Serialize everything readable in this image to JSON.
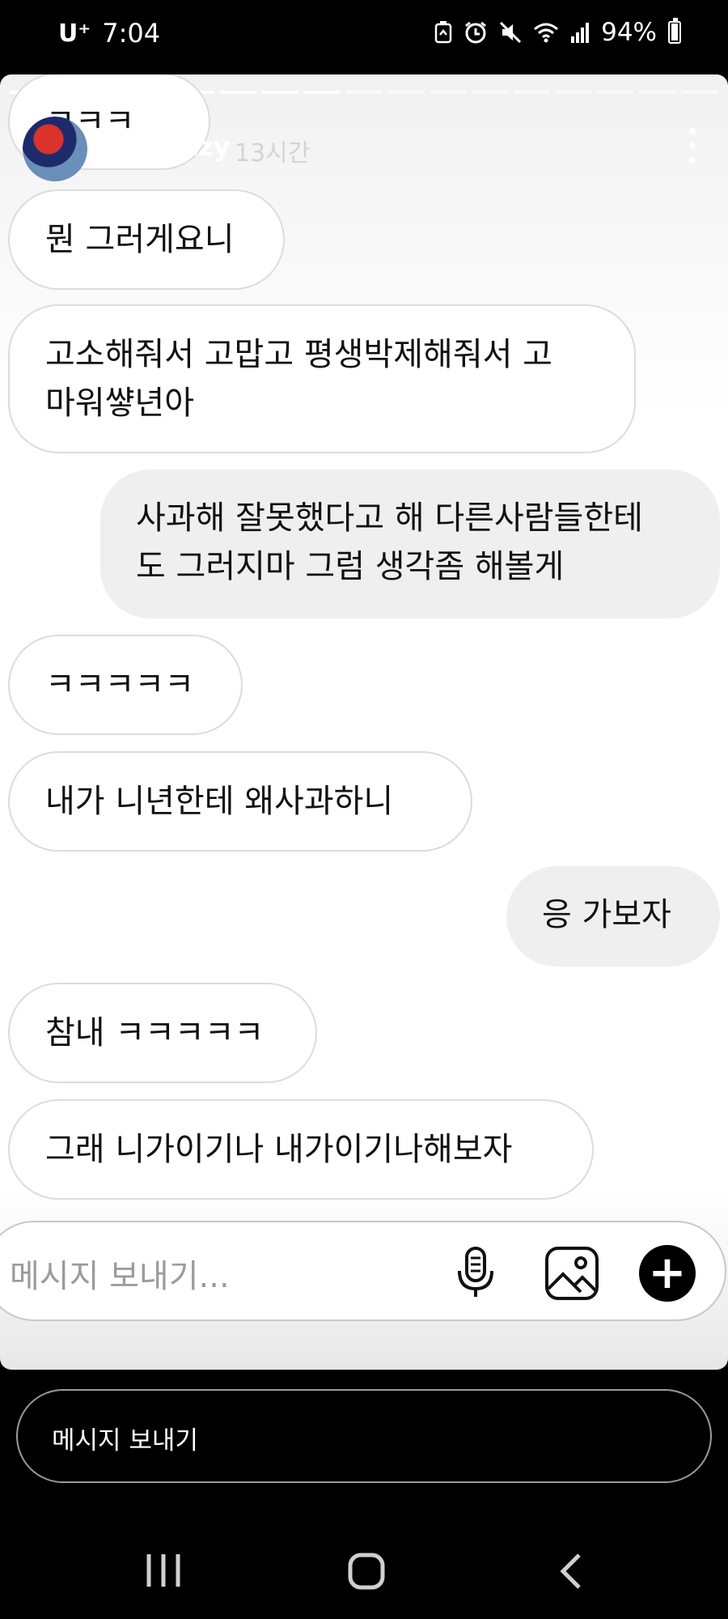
{
  "status_bar": {
    "carrier": "U⁺",
    "time": "7:04",
    "battery": "94%"
  },
  "story": {
    "progress": {
      "total_segments": 17,
      "completed_segments": 8
    },
    "username": "luvlyzzy",
    "time_ago": "13시간"
  },
  "messages": [
    {
      "text": "ㅋㅋㅋ",
      "sender": "other"
    },
    {
      "text": "뭔 그러게요니",
      "sender": "other"
    },
    {
      "text": "고소해줘서 고맙고  평생박제해줘서 고\n마워썋년아",
      "sender": "other"
    },
    {
      "text": "사과해 잘못했다고 해 다른사람들한테\n도 그러지마 그럼 생각좀 해볼게",
      "sender": "me"
    },
    {
      "text": "ㅋㅋㅋㅋㅋ",
      "sender": "other"
    },
    {
      "text": "내가  니년한테  왜사과하니",
      "sender": "other"
    },
    {
      "text": "응 가보자",
      "sender": "me"
    },
    {
      "text": "참내 ㅋㅋㅋㅋㅋ",
      "sender": "other"
    },
    {
      "text": "그래  니가이기나 내가이기나해보자",
      "sender": "other"
    }
  ],
  "composer": {
    "placeholder": "메시지 보내기...",
    "icons": [
      "microphone-icon",
      "gallery-icon",
      "plus-icon"
    ]
  },
  "reply_box": {
    "placeholder": "메시지 보내기"
  },
  "nav_bar": {
    "icons": [
      "recent-apps-icon",
      "home-icon",
      "back-icon"
    ]
  }
}
